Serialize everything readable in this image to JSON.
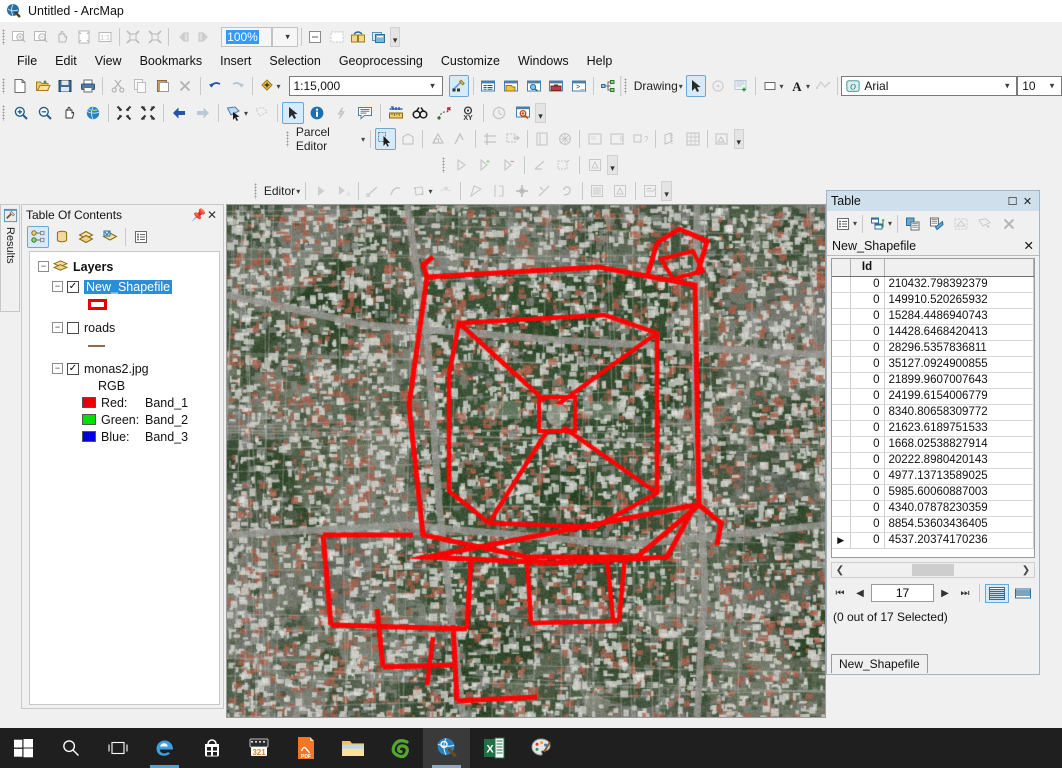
{
  "window": {
    "title": "Untitled - ArcMap",
    "app_icon": "arcmap-globe-icon"
  },
  "layout_toolbar": {
    "zoom_value": "100%",
    "buttons": [
      "zoom-in-layout-icon",
      "zoom-out-layout-icon",
      "pan-layout-icon",
      "zoom-whole-page-icon",
      "zoom-100-icon",
      "fixed-zoom-in-icon",
      "fixed-zoom-out-icon",
      "go-back-extent-icon",
      "go-forward-extent-icon",
      "toggle-draft-mode-icon",
      "focus-data-frame-icon",
      "change-layout-icon",
      "data-driven-pages-icon"
    ]
  },
  "menubar": {
    "items": [
      {
        "label": "File"
      },
      {
        "label": "Edit"
      },
      {
        "label": "View"
      },
      {
        "label": "Bookmarks"
      },
      {
        "label": "Insert"
      },
      {
        "label": "Selection"
      },
      {
        "label": "Geoprocessing"
      },
      {
        "label": "Customize"
      },
      {
        "label": "Windows"
      },
      {
        "label": "Help"
      }
    ]
  },
  "standard_toolbar": {
    "scale_value": "1:15,000",
    "buttons": [
      "new-map-icon",
      "open-icon",
      "save-icon",
      "print-icon",
      "cut-icon",
      "copy-icon",
      "paste-icon",
      "delete-icon",
      "undo-icon",
      "redo-icon",
      "add-data-icon",
      "editor-toolbar-icon",
      "table-of-contents-icon",
      "catalog-window-icon",
      "search-window-icon",
      "toolbox-window-icon",
      "python-window-icon",
      "model-builder-icon"
    ]
  },
  "tools_toolbar": {
    "buttons": [
      "zoom-in-icon",
      "zoom-out-icon",
      "pan-icon",
      "full-extent-icon",
      "fixed-zoom-in-icon",
      "fixed-zoom-out-icon",
      "previous-extent-icon",
      "next-extent-icon",
      "select-features-icon",
      "clear-selected-features-icon",
      "select-elements-icon",
      "identify-icon",
      "hyperlink-icon",
      "html-popup-icon",
      "measure-icon",
      "find-icon",
      "find-route-icon",
      "go-to-xy-icon",
      "time-slider-icon",
      "create-viewer-window-icon"
    ]
  },
  "drawing_toolbar": {
    "label": "Drawing",
    "font_name": "Arial",
    "font_size": "10",
    "buttons": [
      "select-elements-icon",
      "rotate-icon",
      "new-group-icon",
      "fill-color-icon",
      "font-color-icon",
      "nudge-icon"
    ]
  },
  "parcel_editor_toolbar": {
    "label": "Parcel Editor",
    "buttons": [
      "parcel-select-icon",
      "parcel-explorer-icon",
      "construct-parcel-icon",
      "parcel-traverse-icon",
      "parcel-divide-icon",
      "parcel-merge-icon",
      "parcel-details-icon",
      "parcel-join-icon",
      "parcel-remainder-icon",
      "parcel-report-icon",
      "parcel-history-icon",
      "parcel-layer-icon"
    ]
  },
  "topology_toolbar": {
    "buttons": [
      "topology-edit-icon",
      "topology-add-icon",
      "topology-subtract-icon",
      "topology-angle-icon",
      "topology-reshape-icon",
      "topology-validate-icon",
      "topology-error-inspector-icon"
    ]
  },
  "editor_toolbar": {
    "label": "Editor",
    "buttons": [
      "edit-tool-icon",
      "edit-annotation-icon",
      "straight-segment-icon",
      "arc-segment-icon",
      "construct-tool-icon",
      "trace-tool-icon",
      "reshape-feature-icon",
      "split-tool-icon",
      "rotate-tool-icon",
      "cut-polygons-icon",
      "undo-edit-icon",
      "attributes-icon",
      "sketch-properties-icon",
      "create-features-icon"
    ]
  },
  "toc": {
    "title": "Table Of Contents",
    "pin_icon": "pin-icon",
    "close_icon": "close-icon",
    "toolbar_buttons": [
      "list-by-drawing-order-icon",
      "list-by-source-icon",
      "list-by-visibility-icon",
      "list-by-selection-icon",
      "options-icon"
    ],
    "root": "Layers",
    "layers": [
      {
        "name": "New_Shapefile",
        "checked": true,
        "selected": true,
        "symbol": "polygon-outline-red",
        "symbol_color": "#e60000"
      },
      {
        "name": "roads",
        "checked": false,
        "selected": false,
        "symbol": "line-brown",
        "symbol_color": "#9a6b3a"
      },
      {
        "name": "monas2.jpg",
        "checked": true,
        "selected": false,
        "symbol": "rgb-composite",
        "rgb_label": "RGB",
        "bands": [
          {
            "label": "Red:",
            "band": "Band_1",
            "color": "#e60000"
          },
          {
            "label": "Green:",
            "band": "Band_2",
            "color": "#00e000"
          },
          {
            "label": "Blue:",
            "band": "Band_3",
            "color": "#0000e0"
          }
        ]
      }
    ]
  },
  "left_dock": {
    "label": "Results",
    "icon": "results-tool-icon"
  },
  "table_window": {
    "title": "Table",
    "restore_icon": "restore-icon",
    "close_icon": "close-icon",
    "toolbar_buttons": [
      "table-options-icon",
      "related-tables-icon",
      "show-all-records-icon",
      "show-selected-records-icon",
      "zoom-to-selected-icon",
      "select-by-attributes-icon",
      "clear-selection-icon"
    ],
    "tab_name": "New_Shapefile",
    "tab_close_icon": "close-icon",
    "columns": [
      "",
      "Id",
      ""
    ],
    "rows": [
      {
        "marker": "",
        "id": "0",
        "value": "210432.798392379"
      },
      {
        "marker": "",
        "id": "0",
        "value": "149910.520265932"
      },
      {
        "marker": "",
        "id": "0",
        "value": "15284.4486940743"
      },
      {
        "marker": "",
        "id": "0",
        "value": "14428.6468420413"
      },
      {
        "marker": "",
        "id": "0",
        "value": "28296.5357836811"
      },
      {
        "marker": "",
        "id": "0",
        "value": "35127.0924900855"
      },
      {
        "marker": "",
        "id": "0",
        "value": "21899.9607007643"
      },
      {
        "marker": "",
        "id": "0",
        "value": "24199.6154006779"
      },
      {
        "marker": "",
        "id": "0",
        "value": "8340.80658309772"
      },
      {
        "marker": "",
        "id": "0",
        "value": "21623.6189751533"
      },
      {
        "marker": "",
        "id": "0",
        "value": "1668.02538827914"
      },
      {
        "marker": "",
        "id": "0",
        "value": "20222.8980420143"
      },
      {
        "marker": "",
        "id": "0",
        "value": "4977.13713589025"
      },
      {
        "marker": "",
        "id": "0",
        "value": "5985.60060887003"
      },
      {
        "marker": "",
        "id": "0",
        "value": "4340.07878230359"
      },
      {
        "marker": "",
        "id": "0",
        "value": "8854.53603436405"
      },
      {
        "marker": "▶",
        "id": "0",
        "value": "4537.20374170236"
      }
    ],
    "nav": {
      "first_icon": "⏮",
      "prev_icon": "◀",
      "record_number": "17",
      "next_icon": "▶",
      "last_icon": "⏭",
      "view_table_icon": "table-view-icon",
      "view_layout_icon": "layout-view-icon"
    },
    "selection_status": "(0 out of 17 Selected)",
    "bottom_tab": "New_Shapefile"
  },
  "taskbar": {
    "items": [
      {
        "name": "start-button",
        "icon": "windows-logo-icon",
        "active": false
      },
      {
        "name": "search-button",
        "icon": "search-icon",
        "active": false
      },
      {
        "name": "task-view-button",
        "icon": "task-view-icon",
        "active": false
      },
      {
        "name": "edge-button",
        "icon": "edge-icon",
        "active": false
      },
      {
        "name": "store-button",
        "icon": "store-icon",
        "active": false
      },
      {
        "name": "movie-maker-button",
        "icon": "calendar-film-icon",
        "active": false
      },
      {
        "name": "pdf-button",
        "icon": "pdf-icon",
        "active": false
      },
      {
        "name": "file-explorer-button",
        "icon": "folder-icon",
        "active": false
      },
      {
        "name": "browser-button",
        "icon": "green-swirl-icon",
        "active": false
      },
      {
        "name": "arcmap-button",
        "icon": "arcmap-globe-icon",
        "active": true
      },
      {
        "name": "excel-button",
        "icon": "excel-icon",
        "active": false
      },
      {
        "name": "paint-button",
        "icon": "paint-icon",
        "active": false
      }
    ]
  },
  "map": {
    "description": "aerial-satellite-imagery-with-red-road-polygons",
    "overlay_color": "#ff0000"
  }
}
